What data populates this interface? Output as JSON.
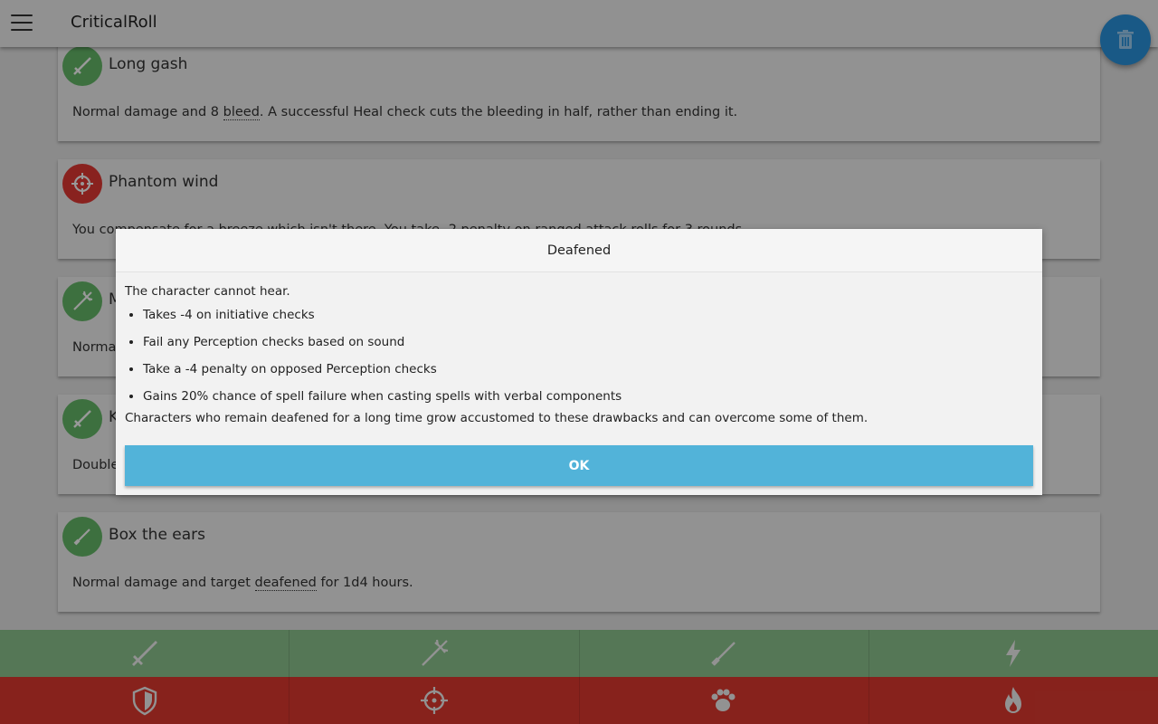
{
  "app": {
    "title": "CriticalRoll"
  },
  "fab": {
    "icon": "trash-icon"
  },
  "cards": [
    {
      "title": "Long gash",
      "icon": "sword-icon",
      "color": "#66bb6a",
      "text_before": "Normal damage and 8 ",
      "term": "bleed",
      "text_after": ". A successful Heal check cuts the bleeding in half, rather than ending it."
    },
    {
      "title": "Phantom wind",
      "icon": "crosshair-icon",
      "color": "#e53935",
      "text_before": "You compensate for a breeze which isn't there. You take -2 penalty on ranged attack rolls for 3 rounds.",
      "term": "",
      "text_after": ""
    },
    {
      "title": "M",
      "icon": "trident-icon",
      "color": "#66bb6a",
      "text_before": "Normal",
      "term": "",
      "text_after": ""
    },
    {
      "title": "K",
      "icon": "sword-icon",
      "color": "#66bb6a",
      "text_before": "Double",
      "term": "",
      "text_after": ""
    },
    {
      "title": "Box the ears",
      "icon": "dagger-icon",
      "color": "#66bb6a",
      "text_before": "Normal damage and target ",
      "term": "deafened",
      "text_after": " for 1d4 hours."
    }
  ],
  "bottom_bar_green": [
    "sword-icon",
    "trident-icon",
    "dagger-icon",
    "lightning-icon"
  ],
  "bottom_bar_red": [
    "shield-icon",
    "crosshair-icon",
    "paw-icon",
    "fire-icon"
  ],
  "modal": {
    "title": "Deafened",
    "intro": "The character cannot hear.",
    "items": [
      "Takes -4 on initiative checks",
      "Fail any Perception checks based on sound",
      "Take a -4 penalty on opposed Perception checks",
      "Gains 20% chance of spell failure when casting spells with verbal components"
    ],
    "outro": "Characters who remain deafened for a long time grow accustomed to these drawbacks and can overcome some of them.",
    "ok_label": "OK"
  },
  "colors": {
    "green_bar": "#8ec78f",
    "red_bar": "#e13a30",
    "fab": "#2a94e0",
    "ok_button": "#52b3d9"
  }
}
